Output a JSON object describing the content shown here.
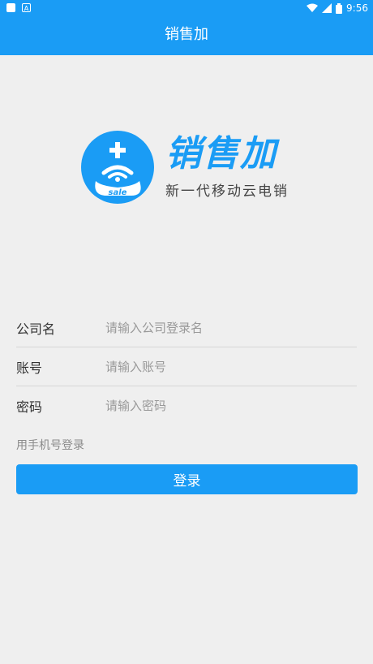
{
  "status_bar": {
    "time": "9:56",
    "left_icons": [
      "notification-square-icon",
      "a-icon"
    ],
    "right_icons": [
      "wifi-icon",
      "signal-icon",
      "battery-icon"
    ]
  },
  "app_bar": {
    "title": "销售加",
    "color": "#1a9cf5"
  },
  "logo": {
    "name": "销售加",
    "slogan": "新一代移动云电销",
    "badge_text": "sale"
  },
  "form": {
    "company": {
      "label": "公司名",
      "placeholder": "请输入公司登录名",
      "value": ""
    },
    "account": {
      "label": "账号",
      "placeholder": "请输入账号",
      "value": ""
    },
    "password": {
      "label": "密码",
      "placeholder": "请输入密码",
      "value": ""
    }
  },
  "phone_login_link": "用手机号登录",
  "login_button": "登录"
}
